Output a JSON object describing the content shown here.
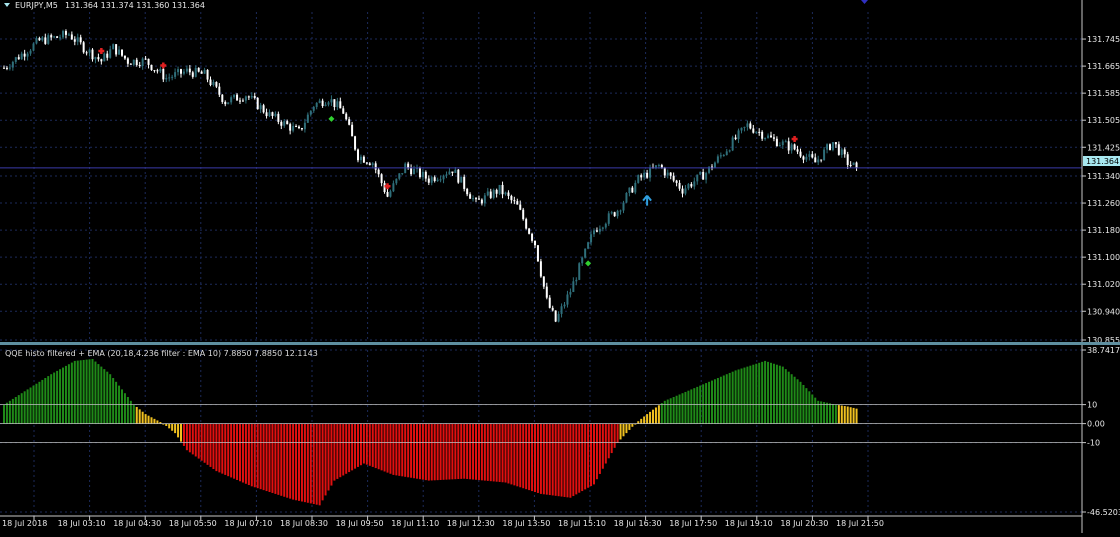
{
  "window": {
    "symbol_label": "EURJPY,M5",
    "ohlc_label": "131.364 131.374 131.360 131.364",
    "indicator_label": "QQE histo filtered + EMA (20,18,4.236 filter : EMA 10) 7.8850 7.8850 12.1143",
    "current_price_label": "131.364"
  },
  "colors": {
    "background": "#000000",
    "grid": "#1c2a5a",
    "bull_candle": "#2f6f7a",
    "bear_candle": "#ffffff",
    "price_line": "#3a3aa8",
    "price_tag_bg": "#a8e8f0",
    "indicator_green": "#1f8a18",
    "indicator_red": "#e01010",
    "indicator_yellow": "#f0c020",
    "level_line": "#c0c0c0",
    "sell_signal": "#e02020",
    "buy_signal_arrow": "#30a0e0",
    "buy_signal_dot": "#30d030"
  },
  "chart_data": [
    {
      "type": "candlestick",
      "title": "EURJPY,M5",
      "ylim": [
        130.855,
        131.825
      ],
      "y_ticks": [
        "131.745",
        "131.665",
        "131.585",
        "131.505",
        "131.425",
        "131.340",
        "131.260",
        "131.180",
        "131.100",
        "131.020",
        "130.940",
        "130.855"
      ],
      "current_price": 131.364,
      "x_ticks": [
        "18 Jul 2018",
        "18 Jul 03:10",
        "18 Jul 04:30",
        "18 Jul 05:50",
        "18 Jul 07:10",
        "18 Jul 08:30",
        "18 Jul 09:50",
        "18 Jul 11:10",
        "18 Jul 12:30",
        "18 Jul 13:50",
        "18 Jul 15:10",
        "18 Jul 16:30",
        "18 Jul 17:50",
        "18 Jul 19:10",
        "18 Jul 20:30",
        "18 Jul 21:50"
      ],
      "close_path": [
        {
          "bar": 0,
          "price": 131.66
        },
        {
          "bar": 6,
          "price": 131.7
        },
        {
          "bar": 12,
          "price": 131.74
        },
        {
          "bar": 18,
          "price": 131.75
        },
        {
          "bar": 22,
          "price": 131.76
        },
        {
          "bar": 27,
          "price": 131.72
        },
        {
          "bar": 33,
          "price": 131.68
        },
        {
          "bar": 37,
          "price": 131.72
        },
        {
          "bar": 42,
          "price": 131.68
        },
        {
          "bar": 48,
          "price": 131.68
        },
        {
          "bar": 55,
          "price": 131.63
        },
        {
          "bar": 62,
          "price": 131.65
        },
        {
          "bar": 68,
          "price": 131.64
        },
        {
          "bar": 75,
          "price": 131.56
        },
        {
          "bar": 82,
          "price": 131.58
        },
        {
          "bar": 90,
          "price": 131.52
        },
        {
          "bar": 100,
          "price": 131.47
        },
        {
          "bar": 105,
          "price": 131.55
        },
        {
          "bar": 110,
          "price": 131.57
        },
        {
          "bar": 115,
          "price": 131.53
        },
        {
          "bar": 120,
          "price": 131.4
        },
        {
          "bar": 125,
          "price": 131.38
        },
        {
          "bar": 130,
          "price": 131.28
        },
        {
          "bar": 136,
          "price": 131.37
        },
        {
          "bar": 144,
          "price": 131.33
        },
        {
          "bar": 152,
          "price": 131.36
        },
        {
          "bar": 160,
          "price": 131.26
        },
        {
          "bar": 168,
          "price": 131.3
        },
        {
          "bar": 174,
          "price": 131.25
        },
        {
          "bar": 180,
          "price": 131.14
        },
        {
          "bar": 184,
          "price": 130.97
        },
        {
          "bar": 187,
          "price": 130.91
        },
        {
          "bar": 192,
          "price": 131.0
        },
        {
          "bar": 200,
          "price": 131.18
        },
        {
          "bar": 208,
          "price": 131.24
        },
        {
          "bar": 215,
          "price": 131.33
        },
        {
          "bar": 222,
          "price": 131.37
        },
        {
          "bar": 230,
          "price": 131.3
        },
        {
          "bar": 238,
          "price": 131.35
        },
        {
          "bar": 245,
          "price": 131.42
        },
        {
          "bar": 252,
          "price": 131.49
        },
        {
          "bar": 260,
          "price": 131.45
        },
        {
          "bar": 268,
          "price": 131.42
        },
        {
          "bar": 275,
          "price": 131.38
        },
        {
          "bar": 281,
          "price": 131.44
        },
        {
          "bar": 286,
          "price": 131.38
        },
        {
          "bar": 289,
          "price": 131.364
        }
      ],
      "sell_signals_bars": [
        33,
        54,
        130,
        268
      ],
      "buy_signals_bars": [
        111,
        198
      ],
      "buy_arrow_bar": 218
    },
    {
      "type": "histogram",
      "title": "QQE histo filtered + EMA",
      "ylim": [
        -46.5203,
        38.7417
      ],
      "y_ticks": [
        "38.7417",
        "10",
        "0.00",
        "-10",
        "-46.5203"
      ],
      "levels": [
        10,
        0,
        -10
      ],
      "value_path": [
        {
          "bar": 0,
          "value": 10
        },
        {
          "bar": 8,
          "value": 18
        },
        {
          "bar": 16,
          "value": 26
        },
        {
          "bar": 24,
          "value": 33
        },
        {
          "bar": 30,
          "value": 34
        },
        {
          "bar": 36,
          "value": 26
        },
        {
          "bar": 44,
          "value": 10
        },
        {
          "bar": 48,
          "value": 5
        },
        {
          "bar": 54,
          "value": 0
        },
        {
          "bar": 58,
          "value": -5
        },
        {
          "bar": 62,
          "value": -14
        },
        {
          "bar": 72,
          "value": -25
        },
        {
          "bar": 84,
          "value": -33
        },
        {
          "bar": 98,
          "value": -40
        },
        {
          "bar": 107,
          "value": -43
        },
        {
          "bar": 112,
          "value": -30
        },
        {
          "bar": 122,
          "value": -21
        },
        {
          "bar": 132,
          "value": -27
        },
        {
          "bar": 144,
          "value": -30
        },
        {
          "bar": 156,
          "value": -29
        },
        {
          "bar": 170,
          "value": -31
        },
        {
          "bar": 182,
          "value": -37
        },
        {
          "bar": 192,
          "value": -39
        },
        {
          "bar": 200,
          "value": -32
        },
        {
          "bar": 208,
          "value": -10
        },
        {
          "bar": 214,
          "value": 0
        },
        {
          "bar": 218,
          "value": 5
        },
        {
          "bar": 224,
          "value": 12
        },
        {
          "bar": 236,
          "value": 20
        },
        {
          "bar": 248,
          "value": 28
        },
        {
          "bar": 258,
          "value": 33
        },
        {
          "bar": 264,
          "value": 30
        },
        {
          "bar": 270,
          "value": 22
        },
        {
          "bar": 276,
          "value": 12
        },
        {
          "bar": 282,
          "value": 10
        },
        {
          "bar": 286,
          "value": 9
        },
        {
          "bar": 289,
          "value": 7.885
        }
      ]
    }
  ]
}
